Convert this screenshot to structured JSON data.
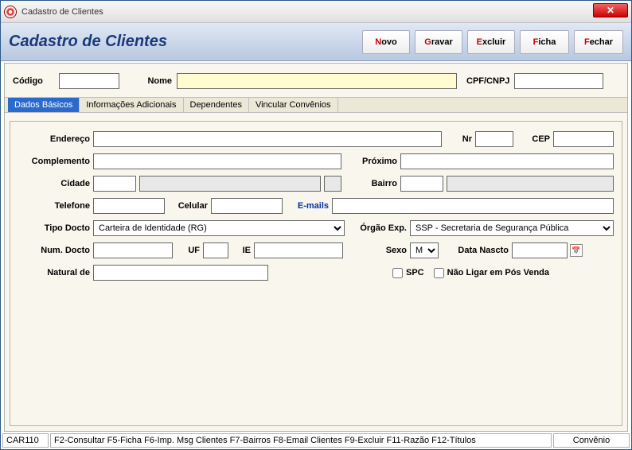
{
  "window": {
    "title": "Cadastro de Clientes"
  },
  "header": {
    "page_title": "Cadastro de Clientes",
    "buttons": {
      "novo": "Novo",
      "gravar": "Gravar",
      "excluir": "Excluir",
      "ficha": "Ficha",
      "fechar": "Fechar"
    }
  },
  "search": {
    "codigo_label": "Código",
    "nome_label": "Nome",
    "cpf_label": "CPF/CNPJ",
    "codigo_value": "",
    "nome_value": "",
    "cpf_value": ""
  },
  "tabs": {
    "t0": "Dados Básicos",
    "t1": "Informações Adicionais",
    "t2": "Dependentes",
    "t3": "Vincular Convênios"
  },
  "form": {
    "endereco_label": "Endereço",
    "nr_label": "Nr",
    "cep_label": "CEP",
    "complemento_label": "Complemento",
    "proximo_label": "Próximo",
    "cidade_label": "Cidade",
    "bairro_label": "Bairro",
    "telefone_label": "Telefone",
    "celular_label": "Celular",
    "emails_label": "E-mails",
    "tipodocto_label": "Tipo Docto",
    "tipodocto_value": "Carteira de Identidade (RG)",
    "orgaoexp_label": "Órgão Exp.",
    "orgaoexp_value": "SSP - Secretaria de Segurança Pública",
    "numdocto_label": "Num. Docto",
    "uf_label": "UF",
    "ie_label": "IE",
    "sexo_label": "Sexo",
    "sexo_value": "M",
    "datanascto_label": "Data Nascto",
    "naturalde_label": "Natural de",
    "spc_label": "SPC",
    "naoligar_label": "Não Ligar em Pós Venda"
  },
  "status": {
    "code": "CAR110",
    "hints": "F2-Consultar  F5-Ficha  F6-Imp. Msg Clientes  F7-Bairros  F8-Email Clientes  F9-Excluir  F11-Razão  F12-Títulos",
    "right": "Convênio"
  }
}
